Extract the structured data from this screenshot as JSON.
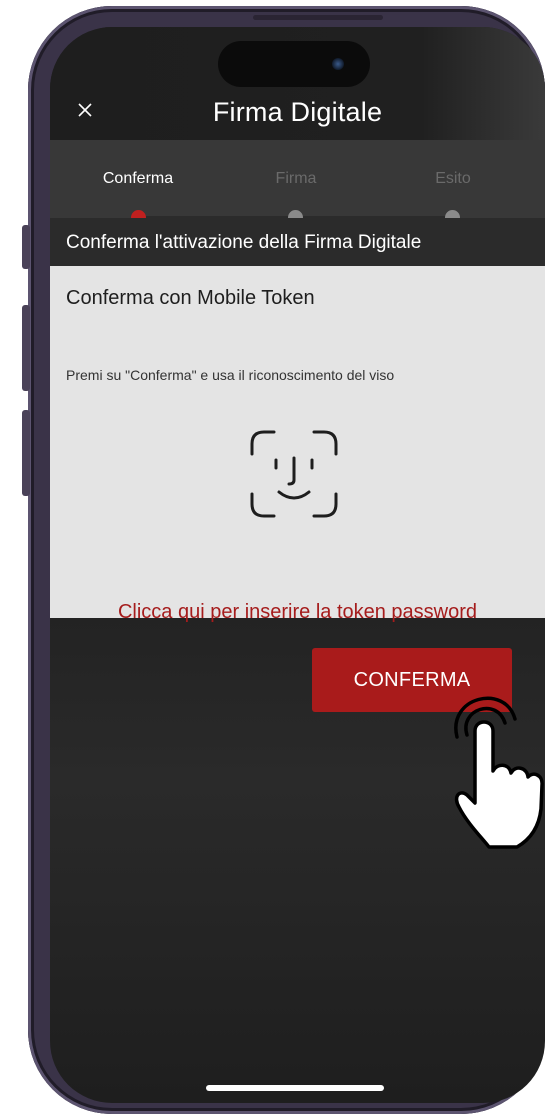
{
  "header": {
    "title": "Firma Digitale",
    "close_icon": "close-icon"
  },
  "stepper": {
    "steps": [
      {
        "label": "Conferma",
        "state": "active"
      },
      {
        "label": "Firma",
        "state": "inactive"
      },
      {
        "label": "Esito",
        "state": "inactive"
      }
    ],
    "active_color": "#c0201f",
    "inactive_color": "#8a8a8a"
  },
  "subtitle": "Conferma l'attivazione della Firma Digitale",
  "card": {
    "title": "Conferma con Mobile Token",
    "hint": "Premi su \"Conferma\" e usa il riconoscimento del viso",
    "icon": "face-id-icon",
    "token_link": "Clicca qui per inserire la token password"
  },
  "actions": {
    "confirm_label": "CONFERMA"
  },
  "colors": {
    "accent": "#a91b1b",
    "link": "#a51c1c",
    "card_bg": "#e4e4e4",
    "background": "#1f1f1f"
  }
}
